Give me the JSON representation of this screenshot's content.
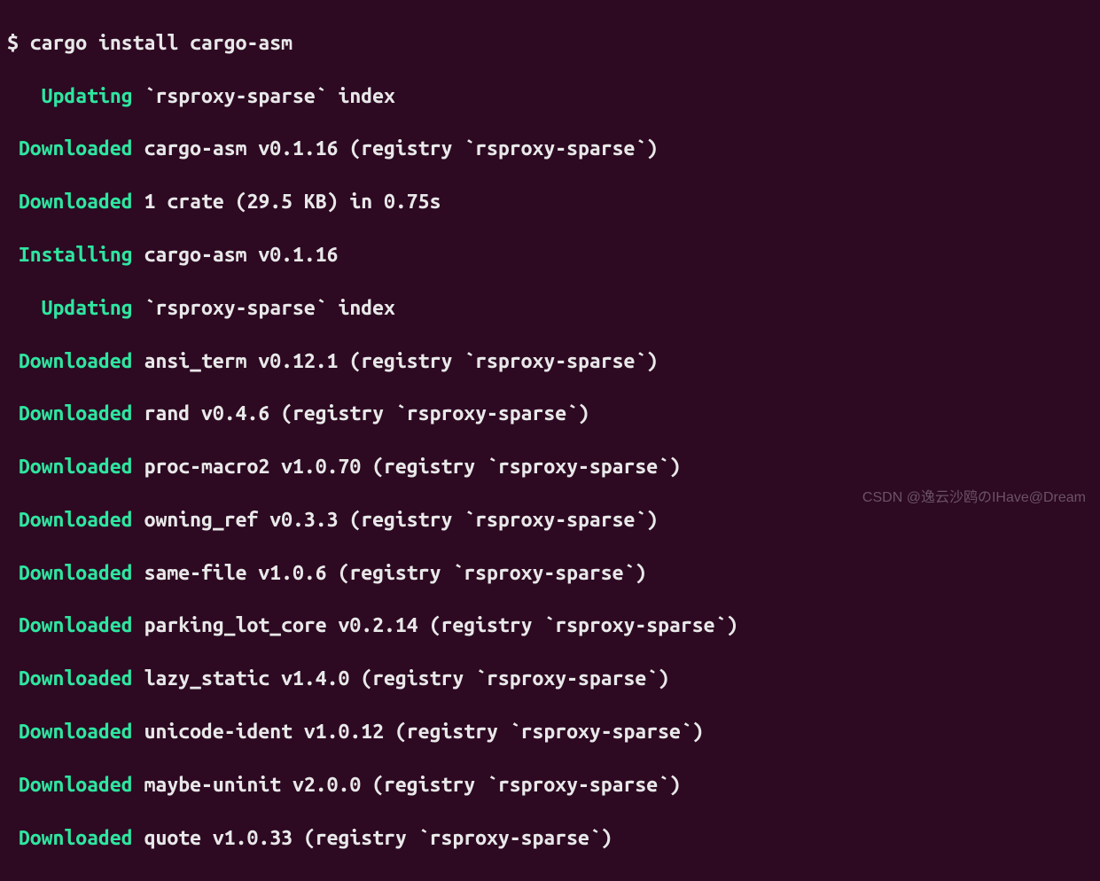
{
  "prompt": "$ ",
  "command": "cargo install cargo-asm",
  "lines": [
    {
      "status": "Updating",
      "text": "`rsproxy-sparse` index"
    },
    {
      "status": "Downloaded",
      "text": "cargo-asm v0.1.16 (registry `rsproxy-sparse`)"
    },
    {
      "status": "Downloaded",
      "text": "1 crate (29.5 KB) in 0.75s"
    },
    {
      "status": "Installing",
      "text": "cargo-asm v0.1.16"
    },
    {
      "status": "Updating",
      "text": "`rsproxy-sparse` index"
    },
    {
      "status": "Downloaded",
      "text": "ansi_term v0.12.1 (registry `rsproxy-sparse`)"
    },
    {
      "status": "Downloaded",
      "text": "rand v0.4.6 (registry `rsproxy-sparse`)"
    },
    {
      "status": "Downloaded",
      "text": "proc-macro2 v1.0.70 (registry `rsproxy-sparse`)"
    },
    {
      "status": "Downloaded",
      "text": "owning_ref v0.3.3 (registry `rsproxy-sparse`)"
    },
    {
      "status": "Downloaded",
      "text": "same-file v1.0.6 (registry `rsproxy-sparse`)"
    },
    {
      "status": "Downloaded",
      "text": "parking_lot_core v0.2.14 (registry `rsproxy-sparse`)"
    },
    {
      "status": "Downloaded",
      "text": "lazy_static v1.4.0 (registry `rsproxy-sparse`)"
    },
    {
      "status": "Downloaded",
      "text": "unicode-ident v1.0.12 (registry `rsproxy-sparse`)"
    },
    {
      "status": "Downloaded",
      "text": "maybe-uninit v2.0.0 (registry `rsproxy-sparse`)"
    },
    {
      "status": "Downloaded",
      "text": "quote v1.0.33 (registry `rsproxy-sparse`)"
    }
  ],
  "watermark": "CSDN @逸云沙鸥のIHave@Dream"
}
